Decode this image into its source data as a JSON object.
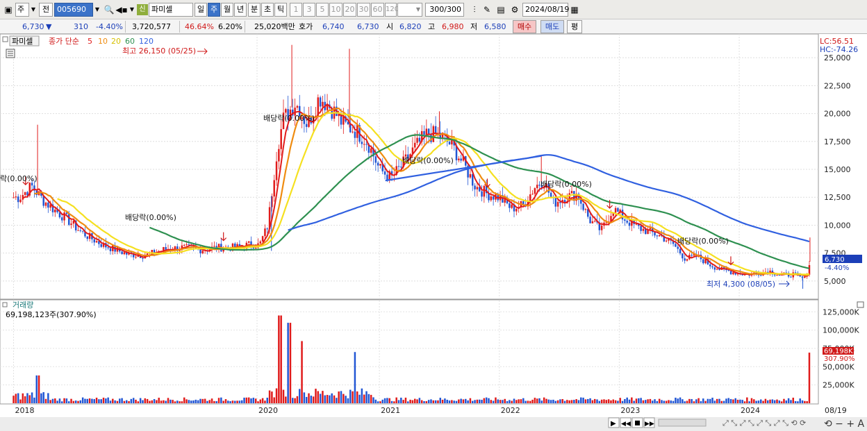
{
  "toolbar": {
    "period_select": "주",
    "prev_label": "전",
    "code": "005690",
    "badge": "신",
    "name": "파미셀",
    "periods": [
      "일",
      "주",
      "월",
      "년",
      "분",
      "초",
      "틱"
    ],
    "active_period": "주",
    "minute_options": [
      "1",
      "3",
      "5",
      "10",
      "20",
      "30",
      "60",
      "120"
    ],
    "count": "300",
    "count_total": "/300",
    "date": "2024/08/19"
  },
  "quote": {
    "price": "6,730",
    "direction": "▼",
    "change": "310",
    "change_pct": "-4.40%",
    "volume": "3,720,577",
    "vol_ratio": "46.64%",
    "turnover_pct": "6.20%",
    "trade_value": "25,020백만",
    "ask_label": "호가",
    "ask": "6,740",
    "bid": "6,730",
    "open_label": "시",
    "open": "6,820",
    "high_label": "고",
    "high": "6,980",
    "low_label": "저",
    "low": "6,580",
    "buy_label": "매수",
    "sell_label": "매도",
    "eval_label": "평"
  },
  "price_panel": {
    "stock_tag": "파미셀",
    "ma_label": "종가 단순",
    "ma_periods": [
      "5",
      "10",
      "20",
      "60",
      "120"
    ],
    "ma_colors": [
      "#e21b1b",
      "#ef8c10",
      "#f5e020",
      "#2e9050",
      "#3060e0"
    ],
    "lc": "LC:56.51",
    "hc": "HC:-74.26",
    "high_note": "최고 26,150 (05/25)",
    "low_note": "최저 4,300 (08/05)",
    "last_price_tag": "6,730",
    "last_pct_tag": "-4.40%",
    "dividend_note": "배당락(0.00%)",
    "dividend_note_first": "락(0.00%)"
  },
  "volume_panel": {
    "title": "거래량",
    "info": "69,198,123주(307.90%)",
    "last_tag": "69,198K",
    "last_pct": "307.90%"
  },
  "chart_data": {
    "type": "candlestick",
    "interval": "weekly",
    "y_axis": [
      "5,000",
      "7,500",
      "10,000",
      "12,500",
      "15,000",
      "17,500",
      "20,000",
      "22,500",
      "25,000"
    ],
    "vol_axis": [
      "25,000K",
      "50,000K",
      "75,000K",
      "100,000K",
      "125,000K"
    ],
    "x_axis": [
      "2018",
      "2020",
      "2021",
      "2022",
      "2023",
      "2024",
      "08/19"
    ],
    "price_range": [
      3500,
      27000
    ],
    "volume_range": [
      0,
      130000
    ],
    "close_path": [
      [
        2018.05,
        12500
      ],
      [
        2018.15,
        13500
      ],
      [
        2018.25,
        12200
      ],
      [
        2018.35,
        11300
      ],
      [
        2018.45,
        10500
      ],
      [
        2018.55,
        9500
      ],
      [
        2018.65,
        8800
      ],
      [
        2018.75,
        8200
      ],
      [
        2018.85,
        7800
      ],
      [
        2018.95,
        7400
      ],
      [
        2019.1,
        7300
      ],
      [
        2019.25,
        7800
      ],
      [
        2019.4,
        8000
      ],
      [
        2019.55,
        7800
      ],
      [
        2019.7,
        8000
      ],
      [
        2019.85,
        8000
      ],
      [
        2019.98,
        8300
      ],
      [
        2020.05,
        8200
      ],
      [
        2020.12,
        10000
      ],
      [
        2020.2,
        17000
      ],
      [
        2020.25,
        19500
      ],
      [
        2020.35,
        21000
      ],
      [
        2020.45,
        19000
      ],
      [
        2020.55,
        21500
      ],
      [
        2020.65,
        20500
      ],
      [
        2020.75,
        19000
      ],
      [
        2020.85,
        18500
      ],
      [
        2020.95,
        17500
      ],
      [
        2021.05,
        15000
      ],
      [
        2021.15,
        14200
      ],
      [
        2021.25,
        15500
      ],
      [
        2021.35,
        17000
      ],
      [
        2021.45,
        18200
      ],
      [
        2021.55,
        18000
      ],
      [
        2021.65,
        17200
      ],
      [
        2021.75,
        15500
      ],
      [
        2021.85,
        13500
      ],
      [
        2021.95,
        12800
      ],
      [
        2022.05,
        12500
      ],
      [
        2022.15,
        11500
      ],
      [
        2022.25,
        11800
      ],
      [
        2022.35,
        13500
      ],
      [
        2022.42,
        14000
      ],
      [
        2022.5,
        12000
      ],
      [
        2022.6,
        12500
      ],
      [
        2022.7,
        12800
      ],
      [
        2022.8,
        10500
      ],
      [
        2022.9,
        9500
      ],
      [
        2023.0,
        11500
      ],
      [
        2023.1,
        10500
      ],
      [
        2023.2,
        9800
      ],
      [
        2023.3,
        9400
      ],
      [
        2023.4,
        9000
      ],
      [
        2023.5,
        8300
      ],
      [
        2023.6,
        7000
      ],
      [
        2023.7,
        7200
      ],
      [
        2023.8,
        6500
      ],
      [
        2023.9,
        6000
      ],
      [
        2024.0,
        5800
      ],
      [
        2024.1,
        5600
      ],
      [
        2024.2,
        5700
      ],
      [
        2024.3,
        5900
      ],
      [
        2024.4,
        5500
      ],
      [
        2024.5,
        5600
      ],
      [
        2024.55,
        5300
      ],
      [
        2024.6,
        5200
      ],
      [
        2024.62,
        6000
      ],
      [
        2024.64,
        6730
      ]
    ],
    "series": [
      {
        "name": "5",
        "color": "#e21b1b"
      },
      {
        "name": "10",
        "color": "#ef8c10"
      },
      {
        "name": "20",
        "color": "#f5e020"
      },
      {
        "name": "60",
        "color": "#2e9050"
      },
      {
        "name": "120",
        "color": "#3060e0"
      }
    ],
    "trendline": [
      [
        2021.1,
        14000
      ],
      [
        2022.4,
        16200
      ]
    ],
    "highs": [
      [
        2018.2,
        19000
      ],
      [
        2020.32,
        26150
      ],
      [
        2020.8,
        25800
      ],
      [
        2021.55,
        20200
      ],
      [
        2022.4,
        16300
      ],
      [
        2024.64,
        8900
      ]
    ],
    "lows": [
      [
        2020.15,
        7700
      ],
      [
        2024.58,
        4300
      ]
    ],
    "dividend_markers": [
      2018.1,
      2019.75,
      2021.95,
      2022.97,
      2023.98
    ],
    "volume_peaks": [
      [
        2018.2,
        38000
      ],
      [
        2020.22,
        120000
      ],
      [
        2020.3,
        110000
      ],
      [
        2020.4,
        85000
      ],
      [
        2020.85,
        70000
      ],
      [
        2024.64,
        69198
      ]
    ]
  }
}
